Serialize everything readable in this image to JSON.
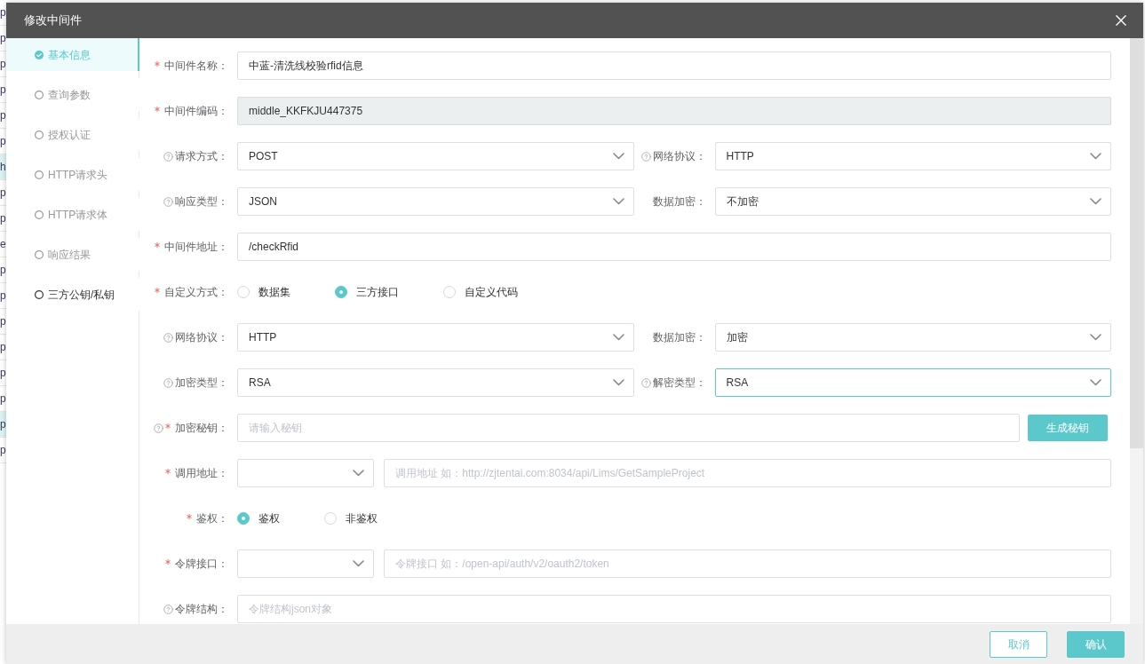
{
  "background_table": {
    "rows": [
      {
        "text": "p",
        "highlighted": false
      },
      {
        "text": "p",
        "highlighted": false
      },
      {
        "text": "p",
        "highlighted": false
      },
      {
        "text": "p",
        "highlighted": false
      },
      {
        "text": "p",
        "highlighted": false
      },
      {
        "text": "p",
        "highlighted": false
      },
      {
        "text": "h",
        "highlighted": true
      },
      {
        "text": "p",
        "highlighted": false
      },
      {
        "text": "p",
        "highlighted": false
      },
      {
        "text": "e",
        "highlighted": false
      },
      {
        "text": "p",
        "highlighted": false
      },
      {
        "text": "p",
        "highlighted": false
      },
      {
        "text": "p",
        "highlighted": false
      },
      {
        "text": "p",
        "highlighted": false
      },
      {
        "text": "p",
        "highlighted": false
      },
      {
        "text": "p",
        "highlighted": false
      },
      {
        "text": "p",
        "highlighted": true
      },
      {
        "text": "p",
        "highlighted": false
      }
    ]
  },
  "dialog": {
    "title": "修改中间件"
  },
  "steps": [
    {
      "label": "基本信息",
      "selected": true,
      "hovered": false
    },
    {
      "label": "查询参数",
      "selected": false,
      "hovered": false
    },
    {
      "label": "授权认证",
      "selected": false,
      "hovered": false
    },
    {
      "label": "HTTP请求头",
      "selected": false,
      "hovered": false
    },
    {
      "label": "HTTP请求体",
      "selected": false,
      "hovered": false
    },
    {
      "label": "响应结果",
      "selected": false,
      "hovered": false
    },
    {
      "label": "三方公钥/私钥",
      "selected": false,
      "hovered": true
    }
  ],
  "form": {
    "rows": [
      {
        "kind": "text",
        "label": "中间件名称：",
        "required": true,
        "value": "中蓝-清洗线校验rfid信息",
        "disabled": false
      },
      {
        "kind": "text",
        "label": "中间件编码：",
        "required": true,
        "value": "middle_KKFKJU447375",
        "disabled": true
      },
      {
        "kind": "pair",
        "left": {
          "label": "请求方式：",
          "help": true,
          "value": "POST",
          "focused": false
        },
        "right": {
          "label": "网络协议：",
          "help": true,
          "value": "HTTP",
          "focused": false
        }
      },
      {
        "kind": "pair",
        "left": {
          "label": "响应类型：",
          "help": true,
          "value": "JSON",
          "focused": false
        },
        "right": {
          "label": "数据加密：",
          "value": "不加密",
          "focused": false
        }
      },
      {
        "kind": "text",
        "label": "中间件地址：",
        "required": true,
        "value": "/checkRfid",
        "disabled": false
      },
      {
        "kind": "radio",
        "label": "自定义方式：",
        "required": true,
        "options": [
          {
            "label": "数据集",
            "selected": false
          },
          {
            "label": "三方接口",
            "selected": true
          },
          {
            "label": "自定义代码",
            "selected": false
          }
        ]
      },
      {
        "kind": "pair",
        "left": {
          "label": "网络协议：",
          "help": true,
          "value": "HTTP",
          "focused": false
        },
        "right": {
          "label": "数据加密：",
          "value": "加密",
          "focused": false
        }
      },
      {
        "kind": "pair",
        "left": {
          "label": "加密类型：",
          "help": true,
          "value": "RSA",
          "focused": false
        },
        "right": {
          "label": "解密类型：",
          "help": true,
          "value": "RSA",
          "focused": true
        }
      },
      {
        "kind": "key",
        "label": "加密秘钥：",
        "required": true,
        "help": true,
        "placeholder": "请输入秘钥",
        "button": "生成秘钥"
      },
      {
        "kind": "combo",
        "label": "调用地址：",
        "required": true,
        "placeholder": "调用地址 如：http://zjtentai.com:8034/api/Lims/GetSampleProject"
      },
      {
        "kind": "radio",
        "label": "鉴权：",
        "required": true,
        "options": [
          {
            "label": "鉴权",
            "selected": true
          },
          {
            "label": "非鉴权",
            "selected": false
          }
        ]
      },
      {
        "kind": "combo",
        "label": "令牌接口：",
        "required": true,
        "placeholder": "令牌接口 如：/open-api/auth/v2/oauth2/token"
      },
      {
        "kind": "text",
        "label": "令牌结构：",
        "help": true,
        "placeholder": "令牌结构json对象",
        "disabled": false
      }
    ]
  },
  "footer": {
    "buttons": [
      {
        "label": "取消",
        "kind": "secondary"
      },
      {
        "label": "确认",
        "kind": "primary"
      }
    ]
  }
}
